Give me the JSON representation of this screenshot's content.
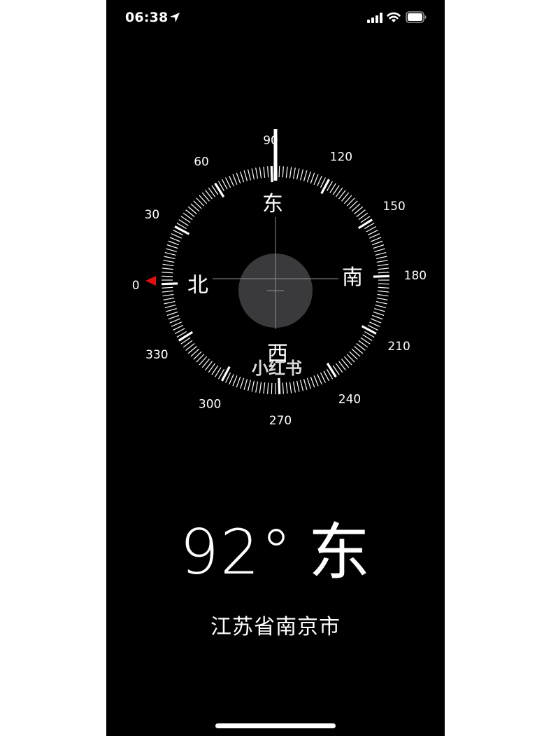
{
  "status_bar": {
    "time": "06:38",
    "icons": [
      "location-arrow-icon",
      "signal-icon",
      "wifi-icon",
      "battery-icon"
    ]
  },
  "compass": {
    "heading_degrees": 92,
    "degree_labels": [
      "0",
      "30",
      "60",
      "90",
      "120",
      "150",
      "180",
      "210",
      "240",
      "270",
      "300",
      "330"
    ],
    "cardinals": {
      "east": "东",
      "south": "南",
      "west": "西",
      "north": "北"
    },
    "watermark": "小红书",
    "colors": {
      "background": "#000000",
      "ticks": "#ffffff",
      "marker": "#e01010",
      "center_disc": "#3a3a3c"
    }
  },
  "readout": {
    "heading": "92°",
    "direction": "东"
  },
  "location": "江苏省南京市"
}
